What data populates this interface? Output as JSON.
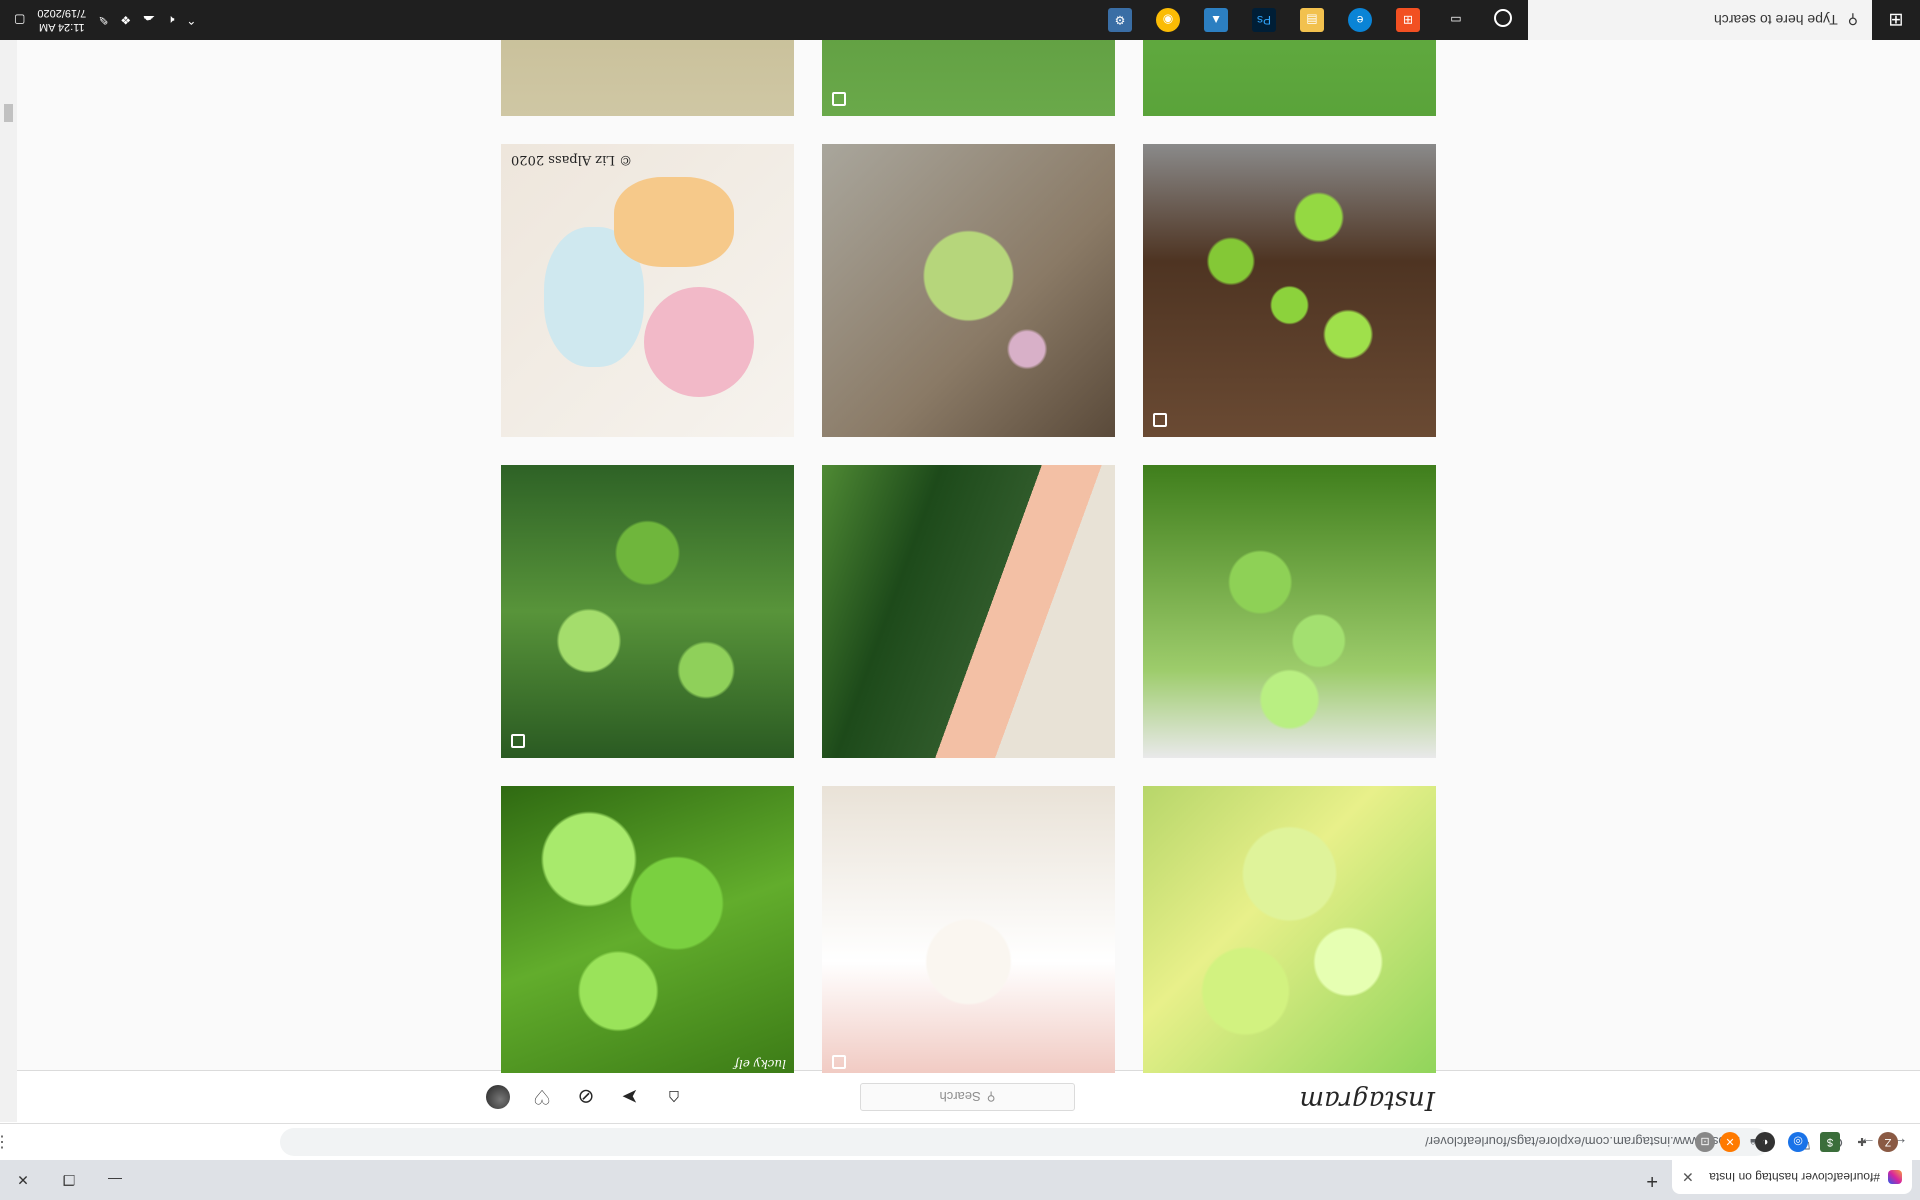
{
  "browser": {
    "tab_title": "#fourleafclover hashtag on Insta",
    "url": "https://www.instagram.com/explore/tags/fourleafclover/",
    "profile_initial": "Z"
  },
  "instagram": {
    "logo": "Instagram",
    "search_placeholder": "Search"
  },
  "grid": {
    "watermark": "© Liz Alpass 2020",
    "signature": "lucky elf"
  },
  "taskbar": {
    "search_placeholder": "Type here to search",
    "time": "11:24 AM",
    "date": "7/19/2020"
  }
}
